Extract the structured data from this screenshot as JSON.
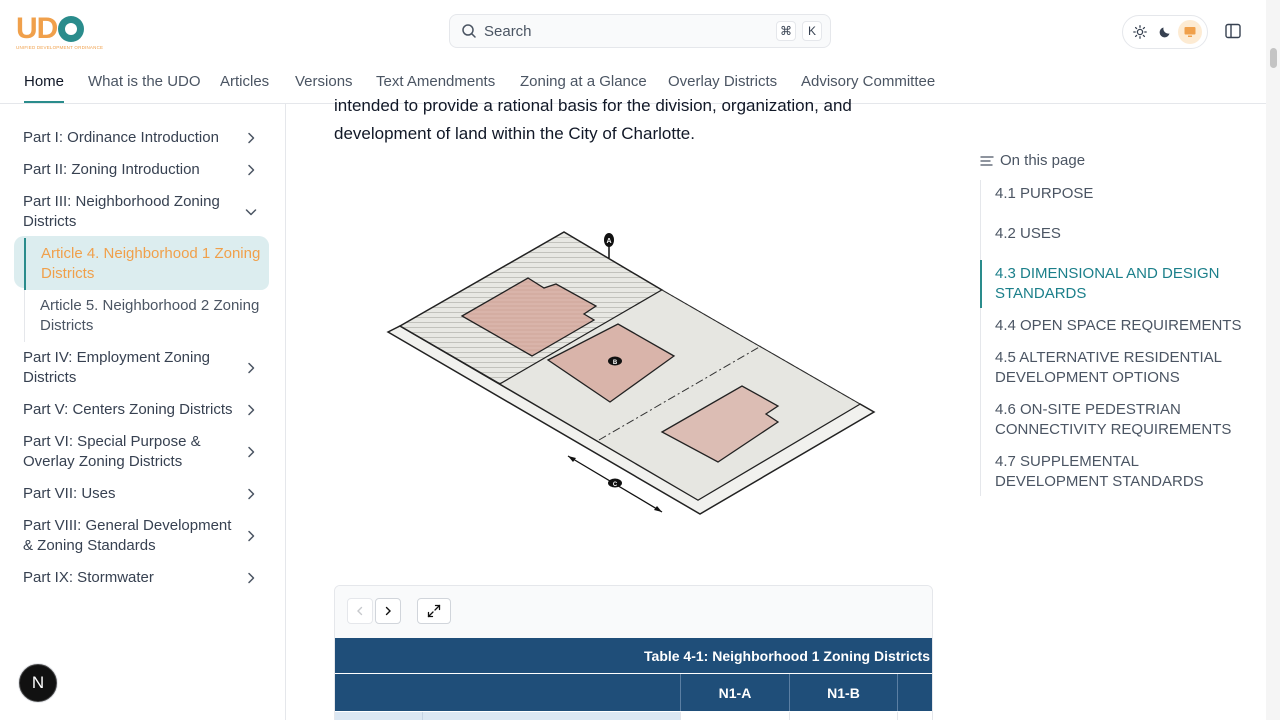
{
  "logo": {
    "text_u": "U",
    "text_d": "D",
    "tagline": "UNIFIED DEVELOPMENT ORDINANCE"
  },
  "search": {
    "placeholder": "Search",
    "kbd_cmd": "⌘",
    "kbd_key": "K"
  },
  "theme": {
    "options": [
      "sun-icon",
      "moon-icon",
      "monitor-icon"
    ],
    "active": "monitor-icon",
    "accent": "#f0a04b"
  },
  "nav": {
    "tabs": [
      {
        "label": "Home",
        "active": true
      },
      {
        "label": "What is the UDO"
      },
      {
        "label": "Articles"
      },
      {
        "label": "Versions"
      },
      {
        "label": "Text Amendments"
      },
      {
        "label": "Zoning at a Glance"
      },
      {
        "label": "Overlay Districts"
      },
      {
        "label": "Advisory Committee"
      }
    ]
  },
  "sidebar": {
    "items": [
      {
        "label": "Part I: Ordinance Introduction"
      },
      {
        "label": "Part II: Zoning Introduction"
      },
      {
        "label": "Part III: Neighborhood Zoning Districts",
        "expanded": true
      },
      {
        "label": "Article 4. Neighborhood 1 Zoning Districts",
        "child": true,
        "active": true
      },
      {
        "label": "Article 5. Neighborhood 2 Zoning Districts",
        "child": true
      },
      {
        "label": "Part IV: Employment Zoning Districts"
      },
      {
        "label": "Part V: Centers Zoning Districts"
      },
      {
        "label": "Part VI: Special Purpose & Overlay Zoning Districts"
      },
      {
        "label": "Part VII: Uses"
      },
      {
        "label": "Part VIII: General Development & Zoning Standards"
      },
      {
        "label": "Part IX: Stormwater"
      }
    ]
  },
  "content": {
    "paragraph": "intended to provide a rational basis for the division, organization, and development of land within the City of Charlotte.",
    "figure_labels": {
      "a": "A",
      "b": "B",
      "c": "C"
    },
    "table": {
      "title": "Table 4-1: Neighborhood 1 Zoning Districts",
      "columns": [
        "",
        "N1-A",
        "N1-B",
        ""
      ]
    }
  },
  "toc": {
    "title": "On this page",
    "items": [
      {
        "label": "4.1 PURPOSE"
      },
      {
        "label": "4.2 USES"
      },
      {
        "label": "4.3 DIMENSIONAL AND DESIGN STANDARDS",
        "active": true
      },
      {
        "label": "4.4 OPEN SPACE REQUIREMENTS"
      },
      {
        "label": "4.5 ALTERNATIVE RESIDENTIAL DEVELOPMENT OPTIONS"
      },
      {
        "label": "4.6 ON-SITE PEDESTRIAN CONNECTIVITY REQUIREMENTS"
      },
      {
        "label": "4.7 SUPPLEMENTAL DEVELOPMENT STANDARDS"
      }
    ]
  },
  "badge": {
    "label": "N"
  }
}
